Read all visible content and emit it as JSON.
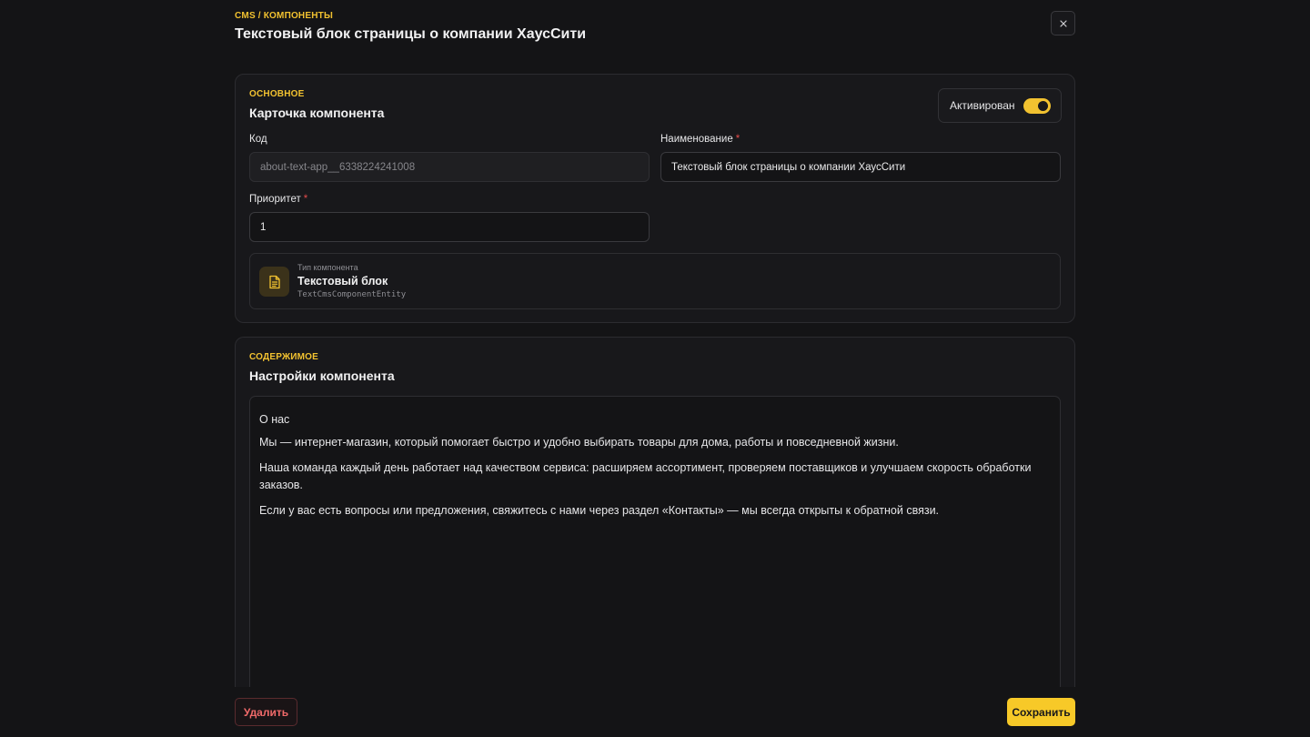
{
  "header": {
    "breadcrumb": "CMS / КОМПОНЕНТЫ",
    "title": "Текстовый блок страницы о компании ХаусСити"
  },
  "main_card": {
    "kicker": "ОСНОВНОЕ",
    "title": "Карточка компонента",
    "active_label": "Активирован",
    "active": true,
    "code_label": "Код",
    "code_value": "about-text-app__6338224241008",
    "name_label": "Наименование",
    "name_required": "*",
    "name_value": "Текстовый блок страницы о компании ХаусСити",
    "priority_label": "Приоритет",
    "priority_required": "*",
    "priority_value": "1",
    "type": {
      "small_label": "Тип компонента",
      "name": "Текстовый блок",
      "class_name": "TextCmsComponentEntity",
      "icon": "document-icon"
    }
  },
  "content_card": {
    "kicker": "СОДЕРЖИМОЕ",
    "title": "Настройки компонента",
    "paragraphs": [
      "О нас",
      "Мы — интернет-магазин, который помогает быстро и удобно выбирать товары для дома, работы и повседневной жизни.",
      "Наша команда каждый день работает над качеством сервиса: расширяем ассортимент, проверяем поставщиков и улучшаем скорость обработки заказов.",
      "Если у вас есть вопросы или предложения, свяжитесь с нами через раздел «Контакты» — мы всегда открыты к обратной связи."
    ]
  },
  "footer": {
    "delete_label": "Удалить",
    "save_label": "Сохранить"
  },
  "colors": {
    "accent": "#f7c928",
    "danger": "#f06a6a",
    "background": "#141416"
  }
}
